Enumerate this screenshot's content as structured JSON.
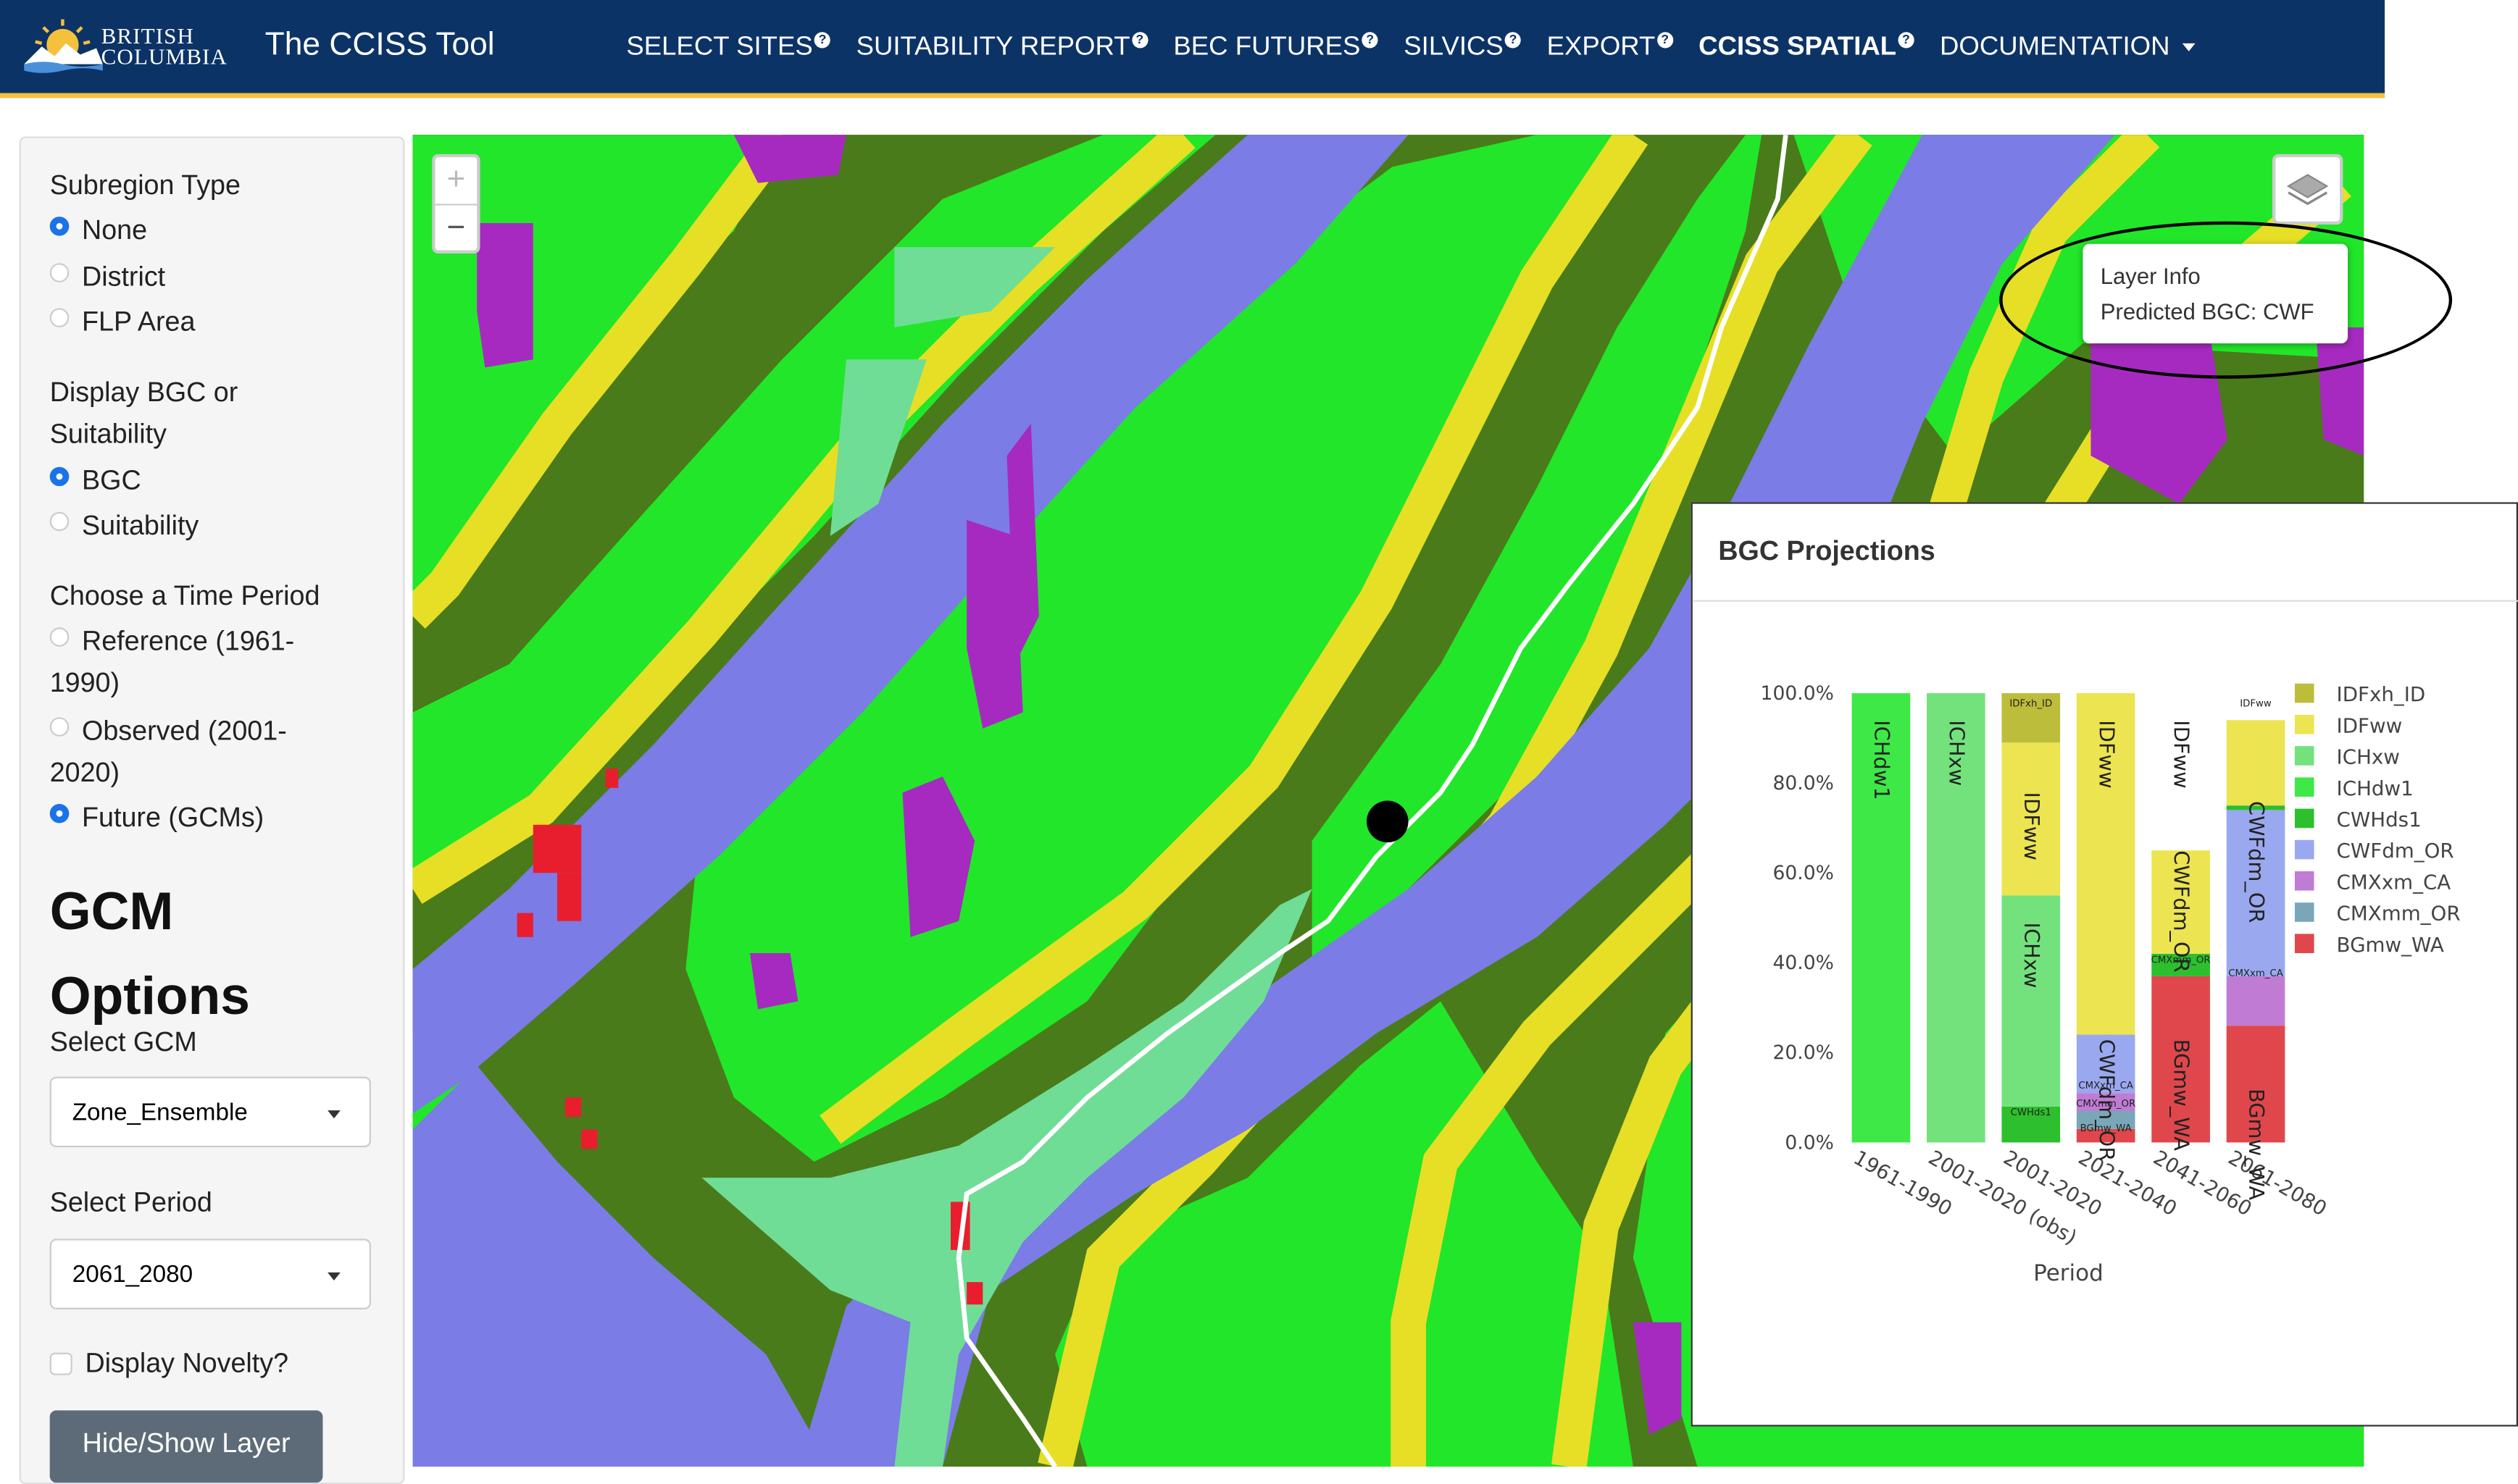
{
  "logo": {
    "line1": "BRITISH",
    "line2": "COLUMBIA"
  },
  "app_title": "The CCISS Tool",
  "nav": [
    {
      "label": "SELECT SITES",
      "help": true
    },
    {
      "label": "SUITABILITY REPORT",
      "help": true
    },
    {
      "label": "BEC FUTURES",
      "help": true
    },
    {
      "label": "SILVICS",
      "help": true
    },
    {
      "label": "EXPORT",
      "help": true
    },
    {
      "label": "CCISS SPATIAL",
      "help": true,
      "active": true
    },
    {
      "label": "DOCUMENTATION",
      "dropdown": true
    }
  ],
  "sidebar": {
    "subregion_label": "Subregion Type",
    "subregion_options": [
      "None",
      "District",
      "FLP Area"
    ],
    "subregion_selected": "None",
    "display_label_1": "Display BGC or",
    "display_label_2": "Suitability",
    "display_options": [
      "BGC",
      "Suitability"
    ],
    "display_selected": "BGC",
    "period_label": "Choose a Time Period",
    "period_options": [
      {
        "l1": "Reference (1961-",
        "l2": "1990)"
      },
      {
        "l1": "Observed (2001-",
        "l2": "2020)"
      },
      {
        "l1": "Future (GCMs)",
        "l2": ""
      }
    ],
    "period_selected": "Future (GCMs)",
    "gcm_heading_1": "GCM",
    "gcm_heading_2": "Options",
    "select_gcm_label": "Select GCM",
    "select_gcm_value": "Zone_Ensemble",
    "select_period_label": "Select Period",
    "select_period_value": "2061_2080",
    "novelty_label": "Display Novelty?",
    "novelty_checked": false,
    "hide_show_button": "Hide/Show Layer"
  },
  "map": {
    "zoom_in": "+",
    "zoom_out": "−",
    "layer_info_title": "Layer Info",
    "layer_info_value": "Predicted BGC: CWF",
    "colors": {
      "dark_green": "#4a7b1a",
      "bright_green": "#22e62a",
      "yellow": "#e6df25",
      "blue": "#7b7ce6",
      "teal": "#6fdd95",
      "purple": "#a62ac0",
      "red": "#e81e2e",
      "road": "#ffffff"
    }
  },
  "chart_panel": {
    "title": "BGC Projections"
  },
  "chart_data": {
    "type": "bar",
    "stacked": true,
    "xlabel": "Period",
    "ylabel": "",
    "ylim": [
      0,
      100
    ],
    "ytick_labels": [
      "0.0%",
      "20.0%",
      "40.0%",
      "60.0%",
      "80.0%",
      "100.0%"
    ],
    "categories": [
      "1961-1990",
      "2001-2020 (obs)",
      "2001-2020",
      "2021-2040",
      "2041-2060",
      "2061-2080"
    ],
    "legend_position": "right",
    "series": [
      {
        "name": "BGmw_WA",
        "color": "#e0474c",
        "values": [
          0,
          0,
          0,
          3,
          37,
          26
        ]
      },
      {
        "name": "CMXmm_OR",
        "color": "#79a7b8",
        "values": [
          0,
          0,
          0,
          4,
          0,
          0
        ]
      },
      {
        "name": "CMXxm_CA",
        "color": "#c07cd4",
        "values": [
          0,
          0,
          0,
          4,
          0,
          11
        ]
      },
      {
        "name": "CWFdm_OR",
        "color": "#9aa8ef",
        "values": [
          0,
          0,
          0,
          13,
          0,
          37
        ]
      },
      {
        "name": "CWHds1",
        "color": "#2dbf2d",
        "values": [
          0,
          0,
          8,
          0,
          5,
          1
        ]
      },
      {
        "name": "ICHdw1",
        "color": "#3ee847",
        "values": [
          100,
          0,
          0,
          0,
          0,
          0
        ]
      },
      {
        "name": "ICHxw",
        "color": "#73e27d",
        "values": [
          0,
          100,
          47,
          0,
          0,
          0
        ]
      },
      {
        "name": "IDFww",
        "color": "#ece451",
        "values": [
          0,
          0,
          34,
          76,
          23,
          19
        ]
      },
      {
        "name": "IDFxh_ID",
        "color": "#bdbd3c",
        "values": [
          0,
          0,
          11,
          0,
          0,
          0
        ]
      }
    ],
    "segment_labels": [
      {
        "category": "1961-1990",
        "text": "ICHdw1",
        "at": 94
      },
      {
        "category": "2001-2020 (obs)",
        "text": "ICHxw",
        "at": 94
      },
      {
        "category": "2001-2020",
        "text": "IDFxh_ID",
        "at": 97
      },
      {
        "category": "2001-2020",
        "text": "IDFww",
        "at": 78
      },
      {
        "category": "2001-2020",
        "text": "ICHxw",
        "at": 49
      },
      {
        "category": "2001-2020",
        "text": "CWHds1",
        "at": 6
      },
      {
        "category": "2021-2040",
        "text": "IDFww",
        "at": 94
      },
      {
        "category": "2021-2040",
        "text": "CWFdm_OR",
        "at": 23
      },
      {
        "category": "2021-2040",
        "text": "CMXxm_CA",
        "at": 12
      },
      {
        "category": "2021-2040",
        "text": "CMXmm_OR",
        "at": 8
      },
      {
        "category": "2021-2040",
        "text": "BGmw_WA",
        "at": 2.5
      },
      {
        "category": "2041-2060",
        "text": "IDFww",
        "at": 94
      },
      {
        "category": "2041-2060",
        "text": "CWFdm_OR",
        "at": 65
      },
      {
        "category": "2041-2060",
        "text": "CMXmm_OR",
        "at": 40
      },
      {
        "category": "2041-2060",
        "text": "BGmw_WA",
        "at": 23
      },
      {
        "category": "2061-2080",
        "text": "IDFww",
        "at": 97
      },
      {
        "category": "2061-2080",
        "text": "CWFdm_OR",
        "at": 76
      },
      {
        "category": "2061-2080",
        "text": "CMXxm_CA",
        "at": 37
      },
      {
        "category": "2061-2080",
        "text": "BGmw_WA",
        "at": 12
      }
    ]
  }
}
